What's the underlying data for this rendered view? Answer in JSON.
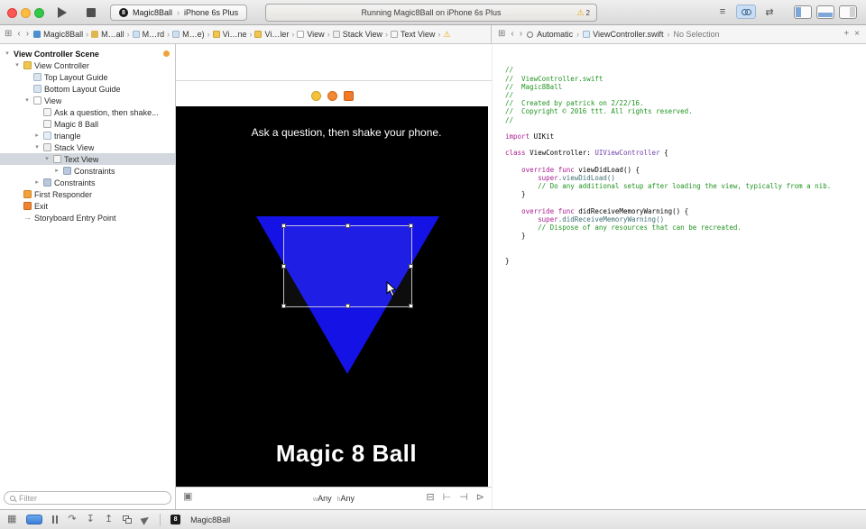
{
  "glyphs": {
    "chevron": "›",
    "back": "‹",
    "forward": "›",
    "related_items": "⊞",
    "warning": "⚠",
    "disclosure_open": "▾",
    "disclosure_closed": "▸",
    "arrow_right": "→",
    "plus": "+",
    "close": "×",
    "bezel": "▣",
    "stack": "⊟",
    "align": "⊢",
    "pin": "⊣",
    "resolve": "⊳",
    "standard_editor": "≡",
    "version_editor": "⇄",
    "grid": "▦",
    "step_over": "↷",
    "step_into": "↧",
    "step_out": "↥",
    "eight": "8"
  },
  "toolbar": {
    "scheme_target": "Magic8Ball",
    "scheme_device": "iPhone 6s Plus",
    "status_text": "Running Magic8Ball on iPhone 6s Plus",
    "warning_count": "2"
  },
  "jumpbar_left": {
    "items": [
      {
        "label": "Magic8Ball",
        "icon": "project-icon"
      },
      {
        "label": "M…all",
        "icon": "folder-icon"
      },
      {
        "label": "M…rd",
        "icon": "storyboard-icon"
      },
      {
        "label": "M…e)",
        "icon": "storyboard-icon"
      },
      {
        "label": "Vi…ne",
        "icon": "scene-icon"
      },
      {
        "label": "Vi…ler",
        "icon": "view-controller-icon"
      },
      {
        "label": "View",
        "icon": "view-icon"
      },
      {
        "label": "Stack View",
        "icon": "stack-view-icon"
      },
      {
        "label": "Text View",
        "icon": "text-view-icon"
      }
    ]
  },
  "jumpbar_right": {
    "mode": "Automatic",
    "file": "ViewController.swift",
    "selection": "No Selection"
  },
  "outline": {
    "items": [
      {
        "label": "View Controller Scene",
        "level": 0,
        "disclosure": "open",
        "bold": true,
        "badge": true
      },
      {
        "label": "View Controller",
        "level": 1,
        "disclosure": "open",
        "icon": "view-controller-icon"
      },
      {
        "label": "Top Layout Guide",
        "level": 2,
        "icon": "layout-guide-icon"
      },
      {
        "label": "Bottom Layout Guide",
        "level": 2,
        "icon": "layout-guide-icon"
      },
      {
        "label": "View",
        "level": 2,
        "disclosure": "open",
        "icon": "view-icon"
      },
      {
        "label": "Ask a question, then shake...",
        "level": 3,
        "icon": "label-icon"
      },
      {
        "label": "Magic 8 Ball",
        "level": 3,
        "icon": "label-icon"
      },
      {
        "label": "triangle",
        "level": 3,
        "disclosure": "closed",
        "icon": "image-view-icon"
      },
      {
        "label": "Stack View",
        "level": 3,
        "disclosure": "open",
        "icon": "stack-view-icon"
      },
      {
        "label": "Text View",
        "level": 4,
        "disclosure": "open",
        "icon": "text-view-icon",
        "selected": true
      },
      {
        "label": "Constraints",
        "level": 5,
        "disclosure": "closed",
        "icon": "constraints-icon"
      },
      {
        "label": "Constraints",
        "level": 3,
        "disclosure": "closed",
        "icon": "constraints-icon"
      },
      {
        "label": "First Responder",
        "level": 1,
        "icon": "first-responder-icon"
      },
      {
        "label": "Exit",
        "level": 1,
        "icon": "exit-icon"
      },
      {
        "label": "Storyboard Entry Point",
        "level": 1,
        "icon": "entry-point-icon"
      }
    ],
    "filter_placeholder": "Filter"
  },
  "canvas": {
    "question_label": "Ask a question, then shake your phone.",
    "title_label": "Magic 8 Ball",
    "size_w_prefix": "w",
    "size_w": "Any",
    "size_h_prefix": "h",
    "size_h": "Any"
  },
  "code": {
    "lines": [
      [
        {
          "t": "//",
          "c": "com"
        }
      ],
      [
        {
          "t": "//  ViewController.swift",
          "c": "com"
        }
      ],
      [
        {
          "t": "//  Magic8Ball",
          "c": "com"
        }
      ],
      [
        {
          "t": "//",
          "c": "com"
        }
      ],
      [
        {
          "t": "//  Created by patrick on 2/22/16.",
          "c": "com"
        }
      ],
      [
        {
          "t": "//  Copyright © 2016 ttt. All rights reserved.",
          "c": "com"
        }
      ],
      [
        {
          "t": "//",
          "c": "com"
        }
      ],
      [],
      [
        {
          "t": "import",
          "c": "kw"
        },
        {
          "t": " UIKit",
          "c": "pl"
        }
      ],
      [],
      [
        {
          "t": "class",
          "c": "kw"
        },
        {
          "t": " ViewController: ",
          "c": "pl"
        },
        {
          "t": "UIViewController",
          "c": "ty"
        },
        {
          "t": " {",
          "c": "pl"
        }
      ],
      [],
      [
        {
          "t": "    ",
          "c": "pl"
        },
        {
          "t": "override",
          "c": "kw"
        },
        {
          "t": " ",
          "c": "pl"
        },
        {
          "t": "func",
          "c": "kw"
        },
        {
          "t": " viewDidLoad() {",
          "c": "pl"
        }
      ],
      [
        {
          "t": "        ",
          "c": "pl"
        },
        {
          "t": "super",
          "c": "kw"
        },
        {
          "t": ".viewDidLoad()",
          "c": "fn"
        }
      ],
      [
        {
          "t": "        ",
          "c": "pl"
        },
        {
          "t": "// Do any additional setup after loading the view, typically from a nib.",
          "c": "com"
        }
      ],
      [
        {
          "t": "    }",
          "c": "pl"
        }
      ],
      [],
      [
        {
          "t": "    ",
          "c": "pl"
        },
        {
          "t": "override",
          "c": "kw"
        },
        {
          "t": " ",
          "c": "pl"
        },
        {
          "t": "func",
          "c": "kw"
        },
        {
          "t": " didReceiveMemoryWarning() {",
          "c": "pl"
        }
      ],
      [
        {
          "t": "        ",
          "c": "pl"
        },
        {
          "t": "super",
          "c": "kw"
        },
        {
          "t": ".didReceiveMemoryWarning()",
          "c": "fn"
        }
      ],
      [
        {
          "t": "        ",
          "c": "pl"
        },
        {
          "t": "// Dispose of any resources that can be recreated.",
          "c": "com"
        }
      ],
      [
        {
          "t": "    }",
          "c": "pl"
        }
      ],
      [],
      [],
      [
        {
          "t": "}",
          "c": "pl"
        }
      ]
    ]
  },
  "debugbar": {
    "app_label": "Magic8Ball"
  },
  "colors": {
    "triangle_blue": "#1412e4",
    "selection_highlight": "#d2d8de",
    "warning_yellow": "#eda600",
    "breakpoint_blue": "#3d7ed8"
  }
}
